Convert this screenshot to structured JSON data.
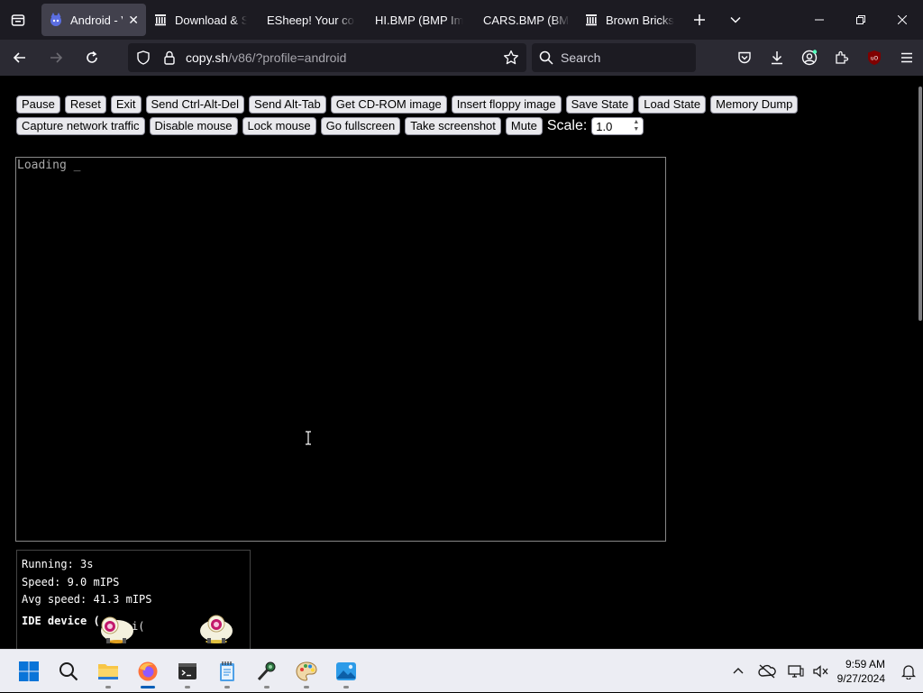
{
  "browser": {
    "tabs": [
      {
        "title": "Android - V",
        "active": true,
        "favicon": "v86-icon"
      },
      {
        "title": "Download & S",
        "active": false,
        "favicon": "archive-icon"
      },
      {
        "title": "ESheep! Your comp",
        "active": false,
        "favicon": "none"
      },
      {
        "title": "HI.BMP (BMP Imag",
        "active": false,
        "favicon": "none"
      },
      {
        "title": "CARS.BMP (BMP I",
        "active": false,
        "favicon": "none"
      },
      {
        "title": "Brown Bricks :",
        "active": false,
        "favicon": "archive-icon"
      }
    ],
    "url_host": "copy.sh",
    "url_path": "/v86/?profile=android",
    "search_placeholder": "Search"
  },
  "emulator": {
    "buttons_row1": [
      "Pause",
      "Reset",
      "Exit",
      "Send Ctrl-Alt-Del",
      "Send Alt-Tab",
      "Get CD-ROM image",
      "Insert floppy image",
      "Save State",
      "Load State",
      "Memory Dump"
    ],
    "buttons_row2": [
      "Capture network traffic",
      "Disable mouse",
      "Lock mouse",
      "Go fullscreen",
      "Take screenshot",
      "Mute"
    ],
    "scale_label": "Scale:",
    "scale_value": "1.0",
    "screen_text": "Loading _",
    "stats": {
      "running": "Running: 3s",
      "speed": "Speed: 9.0 mIPS",
      "avg_speed": "Avg speed: 41.3 mIPS",
      "ide_device": "IDE device (",
      "ide_fragment": "i("
    }
  },
  "taskbar": {
    "apps": [
      "start-icon",
      "search-icon",
      "file-explorer-icon",
      "firefox-icon",
      "terminal-icon",
      "notepad-icon",
      "microphone-app-icon",
      "paint-icon",
      "photos-icon"
    ],
    "time": "9:59 AM",
    "date": "9/27/2024"
  }
}
